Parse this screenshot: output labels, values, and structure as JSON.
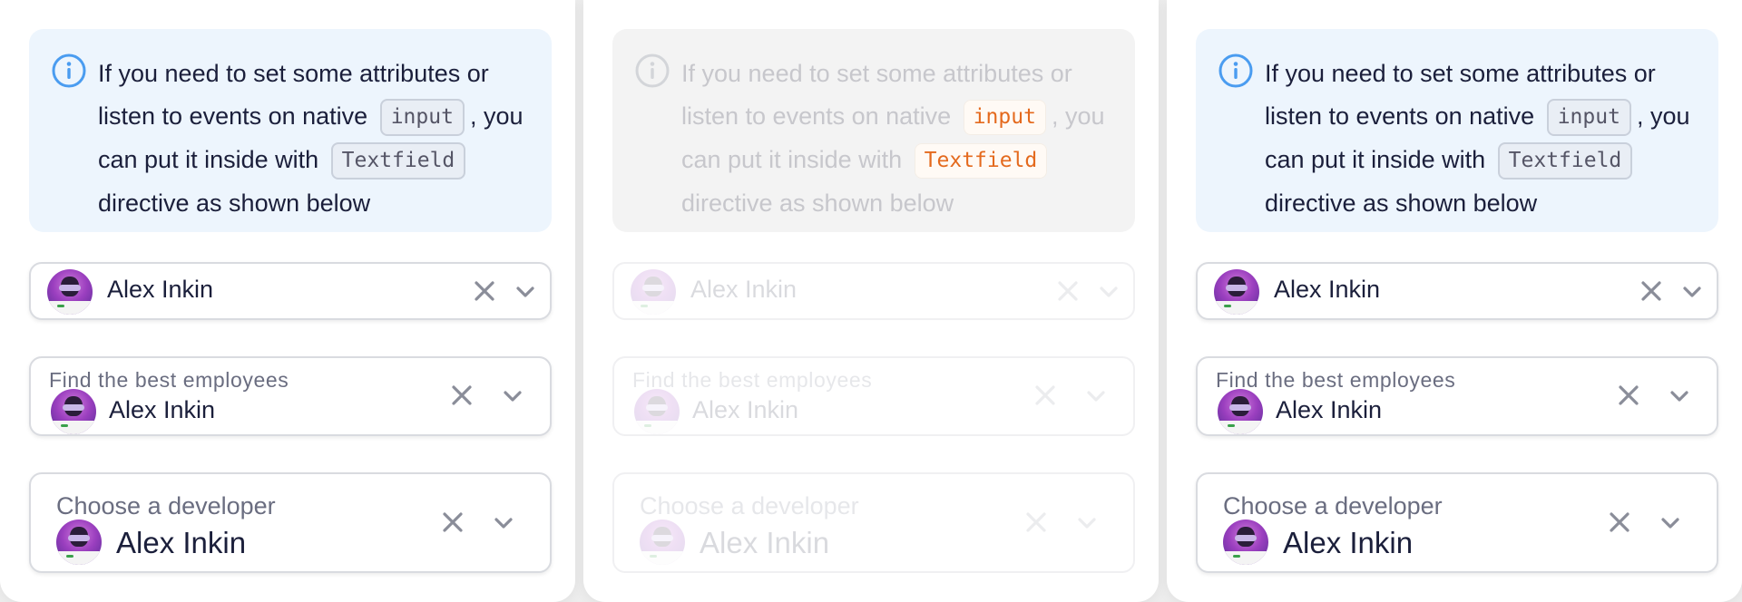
{
  "colors": {
    "background": "#ededed",
    "panel": "#ffffff",
    "notification_bg": "#edf5fd",
    "info_icon": "#4a9cf0",
    "text": "#1b1f3b",
    "label": "#6a6d80",
    "icon_gray": "#8a8d99",
    "code_disabled": "#e46a1e"
  },
  "panels": [
    {
      "state": "enabled",
      "notification": {
        "icon": "info-icon",
        "text_before_input": "If you need to set some attributes or listen to events on native",
        "code_input": "input",
        "text_after_input": ",",
        "text_before_textfield": "you can put it inside with",
        "code_textfield": "Textfield",
        "text_end": "directive as shown below"
      },
      "field_small": {
        "value": "Alex Inkin",
        "avatar": "avatar",
        "clear_icon": "x-icon",
        "dropdown_icon": "chevron-down-icon"
      },
      "field_medium": {
        "label": "Find the best employees",
        "value": "Alex Inkin",
        "avatar": "avatar",
        "clear_icon": "x-icon",
        "dropdown_icon": "chevron-down-icon"
      },
      "field_large": {
        "label": "Choose a developer",
        "value": "Alex Inkin",
        "avatar": "avatar",
        "clear_icon": "x-icon",
        "dropdown_icon": "chevron-down-icon"
      }
    },
    {
      "state": "disabled",
      "notification": {
        "icon": "info-icon",
        "text_before_input": "If you need to set some attributes or listen to events on native",
        "code_input": "input",
        "text_after_input": ",",
        "text_before_textfield": "you can put it inside with",
        "code_textfield": "Textfield",
        "text_end": "directive as shown below"
      },
      "field_small": {
        "value": "Alex Inkin",
        "avatar": "avatar",
        "clear_icon": "x-icon",
        "dropdown_icon": "chevron-down-icon"
      },
      "field_medium": {
        "label": "Find the best employees",
        "value": "Alex Inkin",
        "avatar": "avatar",
        "clear_icon": "x-icon",
        "dropdown_icon": "chevron-down-icon"
      },
      "field_large": {
        "label": "Choose a developer",
        "value": "Alex Inkin",
        "avatar": "avatar",
        "clear_icon": "x-icon",
        "dropdown_icon": "chevron-down-icon"
      }
    },
    {
      "state": "enabled",
      "notification": {
        "icon": "info-icon",
        "text_before_input": "If you need to set some attributes or listen to events on native",
        "code_input": "input",
        "text_after_input": ",",
        "text_before_textfield": "you can put it inside with",
        "code_textfield": "Textfield",
        "text_end": "directive as shown below"
      },
      "field_small": {
        "value": "Alex Inkin",
        "avatar": "avatar",
        "clear_icon": "x-icon",
        "dropdown_icon": "chevron-down-icon"
      },
      "field_medium": {
        "label": "Find the best employees",
        "value": "Alex Inkin",
        "avatar": "avatar",
        "clear_icon": "x-icon",
        "dropdown_icon": "chevron-down-icon"
      },
      "field_large": {
        "label": "Choose a developer",
        "value": "Alex Inkin",
        "avatar": "avatar",
        "clear_icon": "x-icon",
        "dropdown_icon": "chevron-down-icon"
      }
    }
  ]
}
